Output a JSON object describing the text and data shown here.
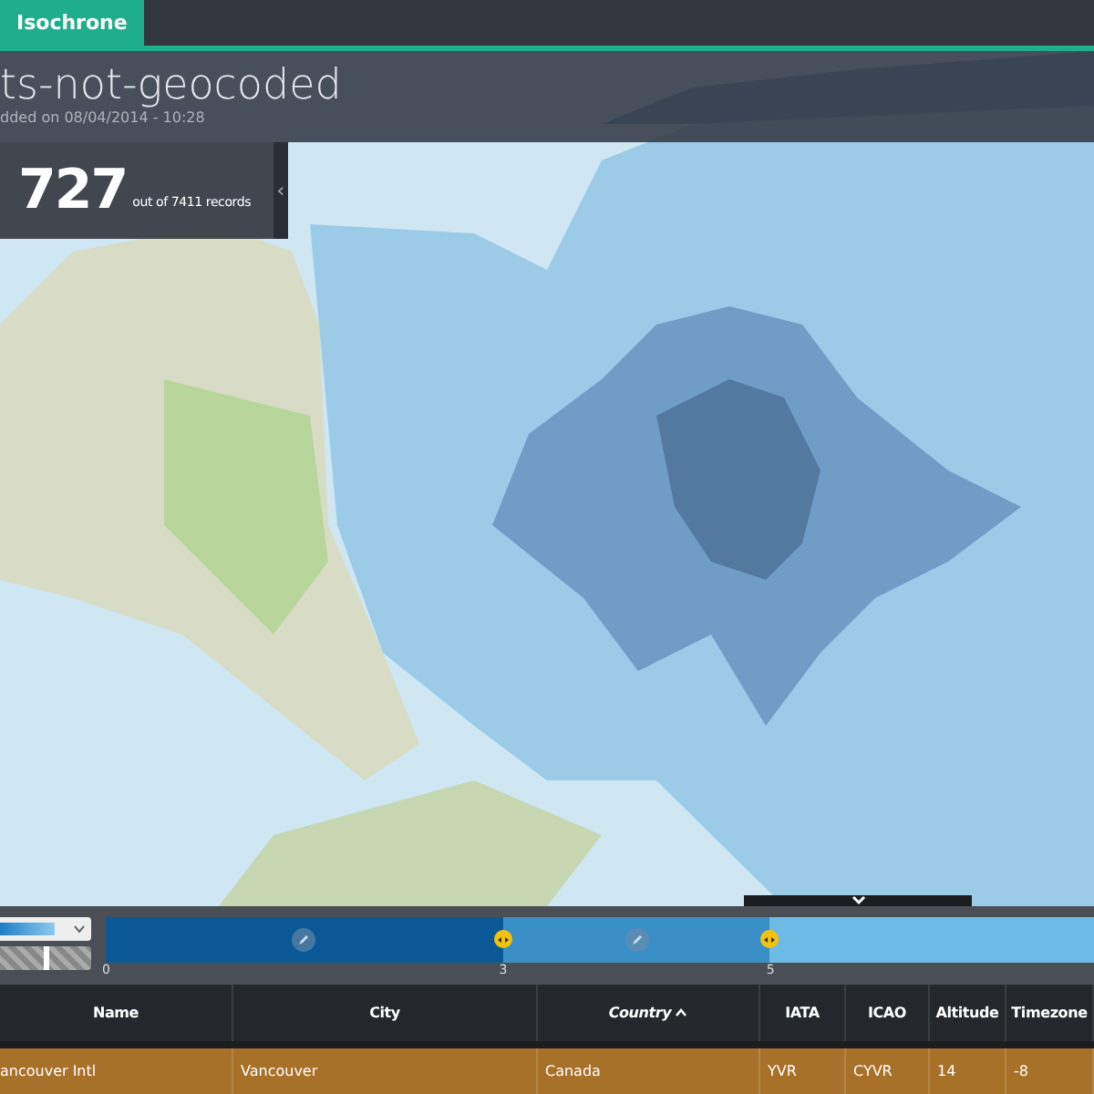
{
  "tabs": [
    {
      "label": "Isochrone",
      "selected": true
    }
  ],
  "header": {
    "title": "ts-not-geocoded",
    "subtitle": "dded on 08/04/2014 - 10:28"
  },
  "count": {
    "value": "727",
    "label": "out of 7411 records",
    "handle": "‹"
  },
  "opacity": {
    "level": 0.5
  },
  "legend": {
    "segments": [
      {
        "color": "#0b5896",
        "editable": true
      },
      {
        "color": "#3a8fc6",
        "editable": true
      },
      {
        "color": "#6dbbe4",
        "editable": false
      }
    ],
    "ticks": [
      "0",
      "3",
      "5"
    ]
  },
  "table": {
    "columns": [
      {
        "label": "Name",
        "sorted": false
      },
      {
        "label": "City",
        "sorted": false
      },
      {
        "label": "Country",
        "sorted": true
      },
      {
        "label": "IATA",
        "sorted": false
      },
      {
        "label": "ICAO",
        "sorted": false
      },
      {
        "label": "Altitude",
        "sorted": false
      },
      {
        "label": "Timezone",
        "sorted": false
      }
    ],
    "rows": [
      {
        "selected": true,
        "cells": [
          "ancouver Intl",
          "Vancouver",
          "Canada",
          "YVR",
          "CYVR",
          "14",
          "-8"
        ]
      }
    ]
  }
}
